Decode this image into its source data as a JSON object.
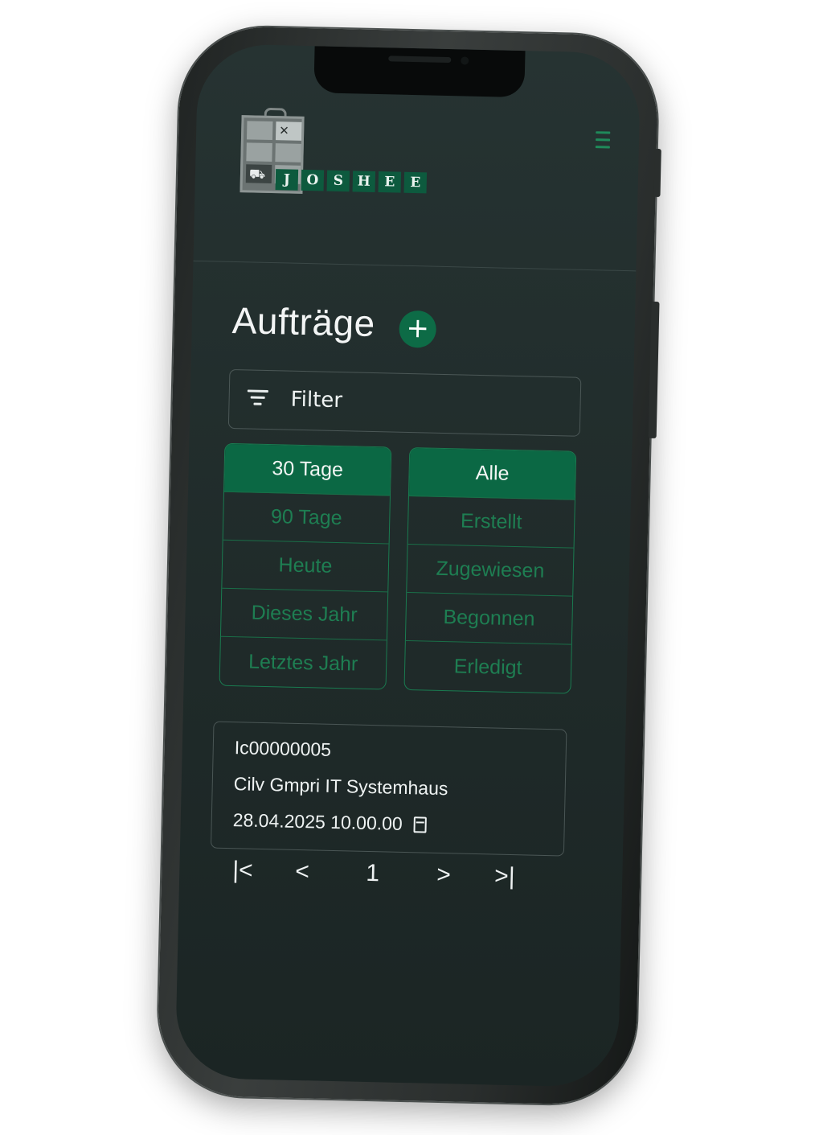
{
  "app": {
    "logo_letters": [
      "J",
      "O",
      "S",
      "H",
      "E",
      "E"
    ]
  },
  "header": {
    "menu_icon": "hamburger-icon"
  },
  "page": {
    "title": "Aufträge",
    "add_label": "+"
  },
  "filter": {
    "label": "Filter",
    "icon": "filter-icon"
  },
  "time_filters": [
    {
      "label": "30 Tage",
      "active": true
    },
    {
      "label": "90 Tage",
      "active": false
    },
    {
      "label": "Heute",
      "active": false
    },
    {
      "label": "Dieses Jahr",
      "active": false
    },
    {
      "label": "Letztes Jahr",
      "active": false
    }
  ],
  "status_filters": [
    {
      "label": "Alle",
      "active": true
    },
    {
      "label": "Erstellt",
      "active": false
    },
    {
      "label": "Zugewiesen",
      "active": false
    },
    {
      "label": "Begonnen",
      "active": false
    },
    {
      "label": "Erledigt",
      "active": false
    }
  ],
  "orders": [
    {
      "id": "Ic00000005",
      "customer": "Cilv Gmpri IT Systemhaus",
      "datetime": "28.04.2025 10.00.00"
    }
  ],
  "pagination": {
    "first": "|<",
    "prev": "<",
    "current": "1",
    "next": ">",
    "last": ">|"
  },
  "colors": {
    "accent": "#0b6844",
    "accent_text": "#1e7e52",
    "background": "#1f2a29"
  }
}
